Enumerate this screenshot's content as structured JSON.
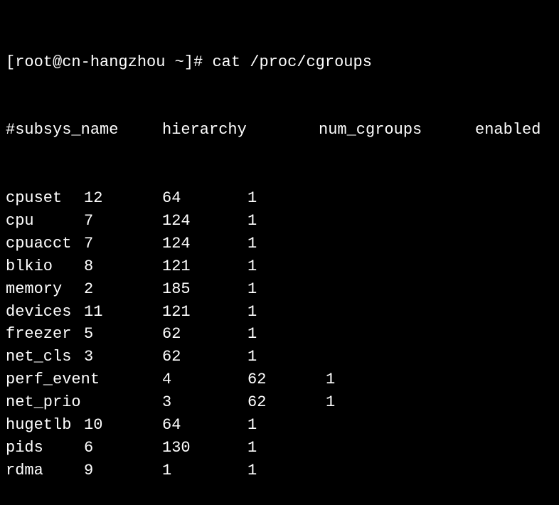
{
  "prompt": {
    "user_host": "[root@cn-hangzhou ~]#",
    "command": "cat /proc/cgroups"
  },
  "header": {
    "subsys": "#subsys_name",
    "hierarchy": "hierarchy",
    "num_cgroups": "num_cgroups",
    "enabled": "enabled"
  },
  "rows": [
    {
      "name": "cpuset",
      "hierarchy": "12",
      "num_cgroups": "64",
      "enabled": "1",
      "wide": false
    },
    {
      "name": "cpu",
      "hierarchy": "7",
      "num_cgroups": "124",
      "enabled": "1",
      "wide": false
    },
    {
      "name": "cpuacct",
      "hierarchy": "7",
      "num_cgroups": "124",
      "enabled": "1",
      "wide": false
    },
    {
      "name": "blkio",
      "hierarchy": "8",
      "num_cgroups": "121",
      "enabled": "1",
      "wide": false
    },
    {
      "name": "memory",
      "hierarchy": "2",
      "num_cgroups": "185",
      "enabled": "1",
      "wide": false
    },
    {
      "name": "devices",
      "hierarchy": "11",
      "num_cgroups": "121",
      "enabled": "1",
      "wide": false
    },
    {
      "name": "freezer",
      "hierarchy": "5",
      "num_cgroups": "62",
      "enabled": "1",
      "wide": false
    },
    {
      "name": "net_cls",
      "hierarchy": "3",
      "num_cgroups": "62",
      "enabled": "1",
      "wide": false
    },
    {
      "name": "perf_event",
      "hierarchy": "4",
      "num_cgroups": "62",
      "enabled": "1",
      "wide": true
    },
    {
      "name": "net_prio",
      "hierarchy": "3",
      "num_cgroups": "62",
      "enabled": "1",
      "wide": true
    },
    {
      "name": "hugetlb",
      "hierarchy": "10",
      "num_cgroups": "64",
      "enabled": "1",
      "wide": false
    },
    {
      "name": "pids",
      "hierarchy": "6",
      "num_cgroups": "130",
      "enabled": "1",
      "wide": false
    },
    {
      "name": "rdma",
      "hierarchy": "9",
      "num_cgroups": "1",
      "enabled": "1",
      "wide": false
    }
  ]
}
